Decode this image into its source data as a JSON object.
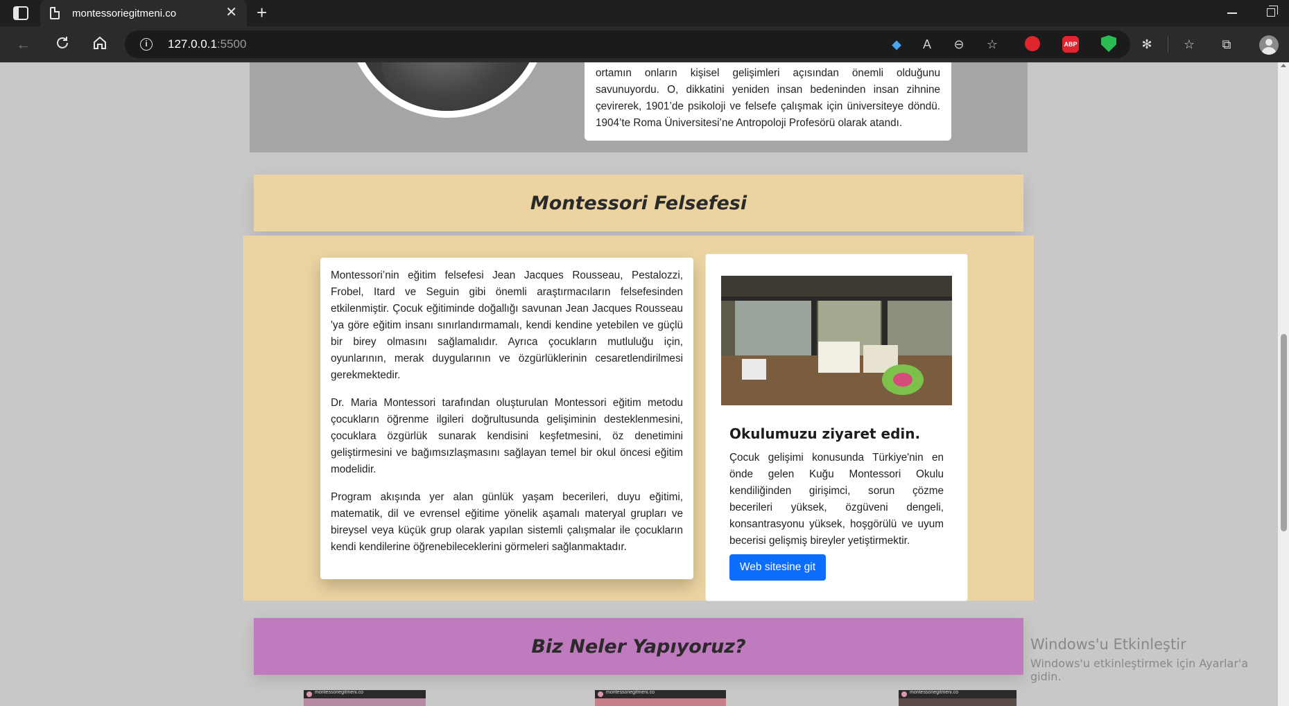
{
  "browser": {
    "tab_title": "montessoriegitmeni.co",
    "url_host": "127.0.0.1",
    "url_port": ":5500"
  },
  "bio": {
    "text": "ortamın onların kişisel gelişimleri açısından önemli olduğunu savunuyordu. O, dikkatini yeniden insan bedeninden insan zihnine çevirerek, 1901’de psikoloji ve felsefe çalışmak için üniversiteye döndü. 1904’te Roma Üniversitesi’ne Antropoloji Profesörü olarak atandı."
  },
  "felsefe": {
    "heading": "Montessori Felsefesi",
    "paragraphs": [
      "Montessori’nin eğitim felsefesi Jean Jacques Rousseau, Pestalozzi, Frobel, Itard ve Seguin gibi önemli araştırmacıların felsefesinden etkilenmiştir. Çocuk eğitiminde doğallığı savunan Jean Jacques Rousseau 'ya göre eğitim insanı sınırlandırmamalı, kendi kendine yetebilen ve güçlü bir birey olmasını sağlamalıdır. Ayrıca çocukların mutluluğu için, oyunlarının, merak duygularının ve özgürlüklerinin cesaretlendirilmesi gerekmektedir.",
      "Dr. Maria Montessori tarafından oluşturulan Montessori eğitim metodu çocukların öğrenme ilgileri doğrultusunda gelişiminin desteklenmesini, çocuklara özgürlük sunarak kendisini keşfetmesini, öz denetimini geliştirmesini ve bağımsızlaşmasını sağlayan temel bir okul öncesi eğitim modelidir.",
      "Program akışında yer alan günlük yaşam becerileri, duyu eğitimi, matematik, dil ve evrensel eğitime yönelik aşamalı materyal grupları ve bireysel veya küçük grup olarak yapılan sistemli çalışmalar ile çocukların kendi kendilerine öğrenebileceklerini görmeleri sağlanmaktadır."
    ]
  },
  "visit": {
    "title": "Okulumuzu ziyaret edin.",
    "text": "Çocuk gelişimi konusunda Türkiye'nin en önde gelen Kuğu Montessori Okulu kendiliğinden girişimci, sorun çözme becerileri yüksek, özgüveni dengeli, konsantrasyonu yüksek, hoşgörülü ve uyum becerisi gelişmiş bireyler yetiştirmektir.",
    "button": "Web sitesine git"
  },
  "neler": {
    "heading": "Biz Neler Yapıyoruz?",
    "thumbs": [
      "montessoriegitmeni.co",
      "montessoriegitmeni.co",
      "montessoriegitmeni.co"
    ]
  },
  "watermark": {
    "line1": "Windows'u Etkinleştir",
    "line2": "Windows'u etkinleştirmek için Ayarlar'a gidin."
  },
  "colors": {
    "felsefe_bg": "#ecd4a2",
    "neler_bg": "#bf7bbd",
    "button": "#0d6efd"
  }
}
